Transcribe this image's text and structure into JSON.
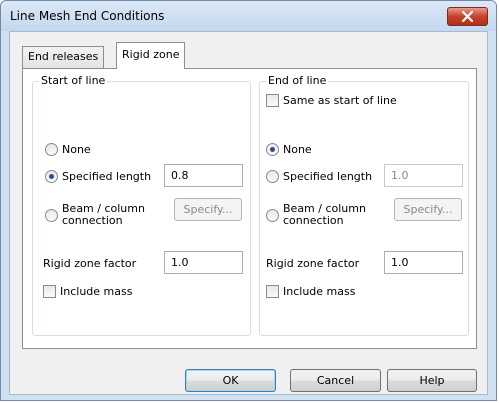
{
  "window": {
    "title": "Line Mesh End Conditions"
  },
  "tabs": [
    {
      "label": "End releases",
      "active": false
    },
    {
      "label": "Rigid zone",
      "active": true
    }
  ],
  "start": {
    "legend": "Start of line",
    "none_label": "None",
    "specified_label": "Specified length",
    "specified_value": "0.8",
    "beam_label_1": "Beam / column",
    "beam_label_2": "connection",
    "specify_label": "Specify...",
    "factor_label": "Rigid zone factor",
    "factor_value": "1.0",
    "mass_label": "Include mass",
    "selected": "specified"
  },
  "end": {
    "legend": "End of line",
    "same_label": "Same as start of line",
    "none_label": "None",
    "specified_label": "Specified length",
    "specified_value": "1.0",
    "beam_label_1": "Beam / column",
    "beam_label_2": "connection",
    "specify_label": "Specify...",
    "factor_label": "Rigid zone factor",
    "factor_value": "1.0",
    "mass_label": "Include mass",
    "selected": "none"
  },
  "buttons": {
    "ok": "OK",
    "cancel": "Cancel",
    "help": "Help"
  },
  "icons": {
    "close": "close-icon"
  },
  "colors": {
    "close_button": "#c7402a",
    "title_bar": "#c3d8ef"
  }
}
